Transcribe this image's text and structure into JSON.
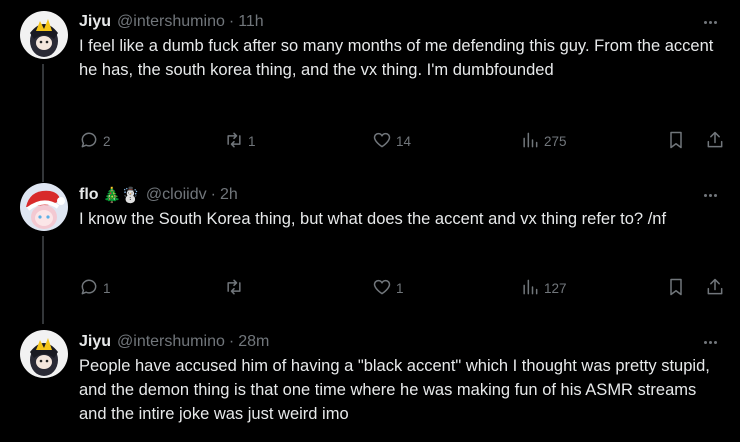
{
  "tweets": [
    {
      "name": "Jiyu",
      "emoji": "",
      "handle": "@intershumino",
      "time": "11h",
      "text": "I feel like a dumb fuck after so many months of me defending this guy. From the accent he has, the south korea thing, and the vx thing. I'm dumbfounded",
      "replies": "2",
      "retweets": "1",
      "likes": "14",
      "views": "275"
    },
    {
      "name": "flo",
      "emoji": "🎄☃️",
      "handle": "@cloiidv",
      "time": "2h",
      "text": "I know the South Korea thing, but what does the accent and vx thing refer to? /nf",
      "replies": "1",
      "retweets": "",
      "likes": "1",
      "views": "127"
    },
    {
      "name": "Jiyu",
      "emoji": "",
      "handle": "@intershumino",
      "time": "28m",
      "text": "People have accused him of having a \"black accent\" which I thought was pretty stupid, and the demon thing is that one time where he was making fun of his ASMR streams and the intire joke was just weird imo"
    }
  ],
  "separator": "·",
  "icons": {
    "reply": "reply-icon",
    "retweet": "retweet-icon",
    "like": "heart-icon",
    "views": "views-icon",
    "bookmark": "bookmark-icon",
    "share": "share-icon",
    "more": "more-icon"
  },
  "colors": {
    "background": "#000000",
    "text": "#e7e9ea",
    "secondary": "#71767b",
    "thread_line": "#333639"
  }
}
